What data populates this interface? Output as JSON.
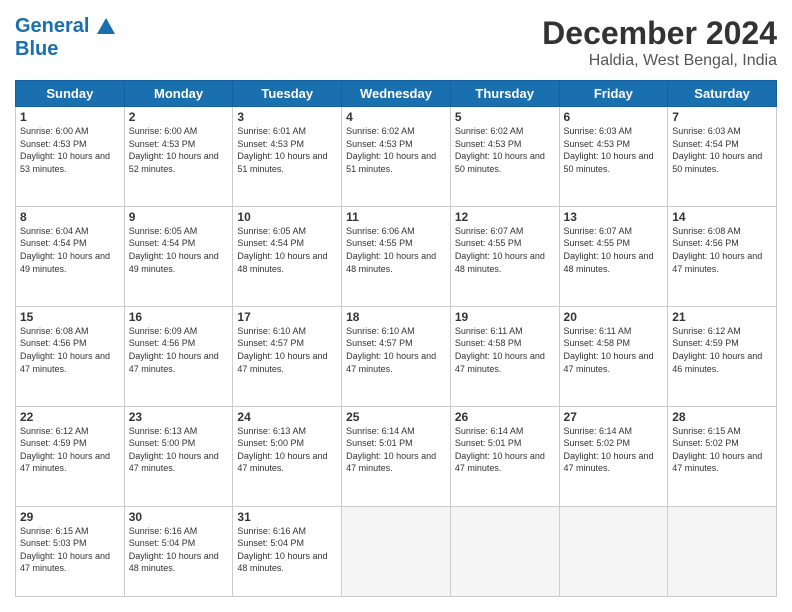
{
  "header": {
    "logo_line1": "General",
    "logo_line2": "Blue",
    "title": "December 2024",
    "subtitle": "Haldia, West Bengal, India"
  },
  "weekdays": [
    "Sunday",
    "Monday",
    "Tuesday",
    "Wednesday",
    "Thursday",
    "Friday",
    "Saturday"
  ],
  "weeks": [
    [
      {
        "day": "1",
        "sunrise": "6:00 AM",
        "sunset": "4:53 PM",
        "daylight": "10 hours and 53 minutes."
      },
      {
        "day": "2",
        "sunrise": "6:00 AM",
        "sunset": "4:53 PM",
        "daylight": "10 hours and 52 minutes."
      },
      {
        "day": "3",
        "sunrise": "6:01 AM",
        "sunset": "4:53 PM",
        "daylight": "10 hours and 51 minutes."
      },
      {
        "day": "4",
        "sunrise": "6:02 AM",
        "sunset": "4:53 PM",
        "daylight": "10 hours and 51 minutes."
      },
      {
        "day": "5",
        "sunrise": "6:02 AM",
        "sunset": "4:53 PM",
        "daylight": "10 hours and 50 minutes."
      },
      {
        "day": "6",
        "sunrise": "6:03 AM",
        "sunset": "4:53 PM",
        "daylight": "10 hours and 50 minutes."
      },
      {
        "day": "7",
        "sunrise": "6:03 AM",
        "sunset": "4:54 PM",
        "daylight": "10 hours and 50 minutes."
      }
    ],
    [
      {
        "day": "8",
        "sunrise": "6:04 AM",
        "sunset": "4:54 PM",
        "daylight": "10 hours and 49 minutes."
      },
      {
        "day": "9",
        "sunrise": "6:05 AM",
        "sunset": "4:54 PM",
        "daylight": "10 hours and 49 minutes."
      },
      {
        "day": "10",
        "sunrise": "6:05 AM",
        "sunset": "4:54 PM",
        "daylight": "10 hours and 48 minutes."
      },
      {
        "day": "11",
        "sunrise": "6:06 AM",
        "sunset": "4:55 PM",
        "daylight": "10 hours and 48 minutes."
      },
      {
        "day": "12",
        "sunrise": "6:07 AM",
        "sunset": "4:55 PM",
        "daylight": "10 hours and 48 minutes."
      },
      {
        "day": "13",
        "sunrise": "6:07 AM",
        "sunset": "4:55 PM",
        "daylight": "10 hours and 48 minutes."
      },
      {
        "day": "14",
        "sunrise": "6:08 AM",
        "sunset": "4:56 PM",
        "daylight": "10 hours and 47 minutes."
      }
    ],
    [
      {
        "day": "15",
        "sunrise": "6:08 AM",
        "sunset": "4:56 PM",
        "daylight": "10 hours and 47 minutes."
      },
      {
        "day": "16",
        "sunrise": "6:09 AM",
        "sunset": "4:56 PM",
        "daylight": "10 hours and 47 minutes."
      },
      {
        "day": "17",
        "sunrise": "6:10 AM",
        "sunset": "4:57 PM",
        "daylight": "10 hours and 47 minutes."
      },
      {
        "day": "18",
        "sunrise": "6:10 AM",
        "sunset": "4:57 PM",
        "daylight": "10 hours and 47 minutes."
      },
      {
        "day": "19",
        "sunrise": "6:11 AM",
        "sunset": "4:58 PM",
        "daylight": "10 hours and 47 minutes."
      },
      {
        "day": "20",
        "sunrise": "6:11 AM",
        "sunset": "4:58 PM",
        "daylight": "10 hours and 47 minutes."
      },
      {
        "day": "21",
        "sunrise": "6:12 AM",
        "sunset": "4:59 PM",
        "daylight": "10 hours and 46 minutes."
      }
    ],
    [
      {
        "day": "22",
        "sunrise": "6:12 AM",
        "sunset": "4:59 PM",
        "daylight": "10 hours and 47 minutes."
      },
      {
        "day": "23",
        "sunrise": "6:13 AM",
        "sunset": "5:00 PM",
        "daylight": "10 hours and 47 minutes."
      },
      {
        "day": "24",
        "sunrise": "6:13 AM",
        "sunset": "5:00 PM",
        "daylight": "10 hours and 47 minutes."
      },
      {
        "day": "25",
        "sunrise": "6:14 AM",
        "sunset": "5:01 PM",
        "daylight": "10 hours and 47 minutes."
      },
      {
        "day": "26",
        "sunrise": "6:14 AM",
        "sunset": "5:01 PM",
        "daylight": "10 hours and 47 minutes."
      },
      {
        "day": "27",
        "sunrise": "6:14 AM",
        "sunset": "5:02 PM",
        "daylight": "10 hours and 47 minutes."
      },
      {
        "day": "28",
        "sunrise": "6:15 AM",
        "sunset": "5:02 PM",
        "daylight": "10 hours and 47 minutes."
      }
    ],
    [
      {
        "day": "29",
        "sunrise": "6:15 AM",
        "sunset": "5:03 PM",
        "daylight": "10 hours and 47 minutes."
      },
      {
        "day": "30",
        "sunrise": "6:16 AM",
        "sunset": "5:04 PM",
        "daylight": "10 hours and 48 minutes."
      },
      {
        "day": "31",
        "sunrise": "6:16 AM",
        "sunset": "5:04 PM",
        "daylight": "10 hours and 48 minutes."
      },
      null,
      null,
      null,
      null
    ]
  ]
}
